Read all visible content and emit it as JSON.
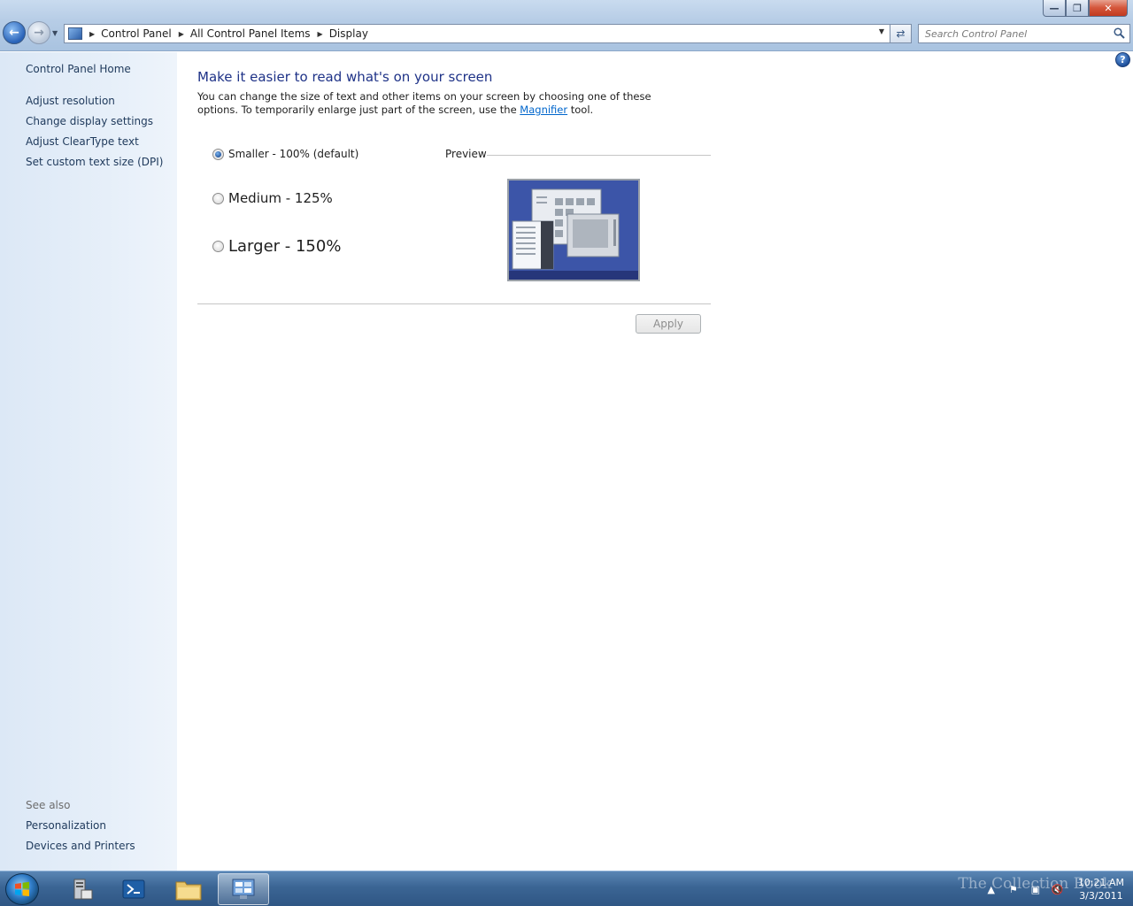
{
  "window": {
    "breadcrumb": [
      "Control Panel",
      "All Control Panel Items",
      "Display"
    ],
    "search_placeholder": "Search Control Panel",
    "controls": {
      "minimize": "—",
      "maximize": "❐",
      "close": "✕"
    }
  },
  "sidebar": {
    "home": "Control Panel Home",
    "tasks": [
      "Adjust resolution",
      "Change display settings",
      "Adjust ClearType text",
      "Set custom text size (DPI)"
    ],
    "see_also_heading": "See also",
    "see_also": [
      "Personalization",
      "Devices and Printers"
    ]
  },
  "main": {
    "title": "Make it easier to read what's on your screen",
    "description_before": "You can change the size of text and other items on your screen by choosing one of these options. To temporarily enlarge just part of the screen, use the",
    "magnifier_link": "Magnifier",
    "description_after": "tool.",
    "options": [
      {
        "label": "Smaller - 100% (default)",
        "selected": true
      },
      {
        "label": "Medium - 125%",
        "selected": false
      },
      {
        "label": "Larger - 150%",
        "selected": false
      }
    ],
    "preview_label": "Preview",
    "apply_label": "Apply"
  },
  "taskbar": {
    "time": "10:21 AM",
    "date": "3/3/2011",
    "watermark": "The Collection Book"
  },
  "icons": {
    "help": "?",
    "back": "←",
    "forward": "→",
    "refresh": "⇄"
  }
}
